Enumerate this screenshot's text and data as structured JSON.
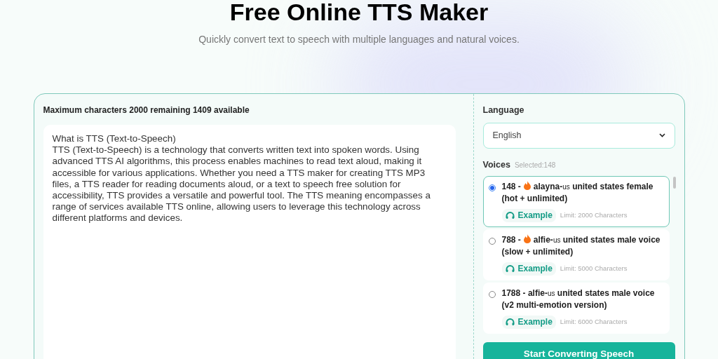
{
  "hero": {
    "title": "Free Online TTS Maker",
    "subtitle": "Quickly convert text to speech with multiple languages and natural voices."
  },
  "editor": {
    "counter": "Maximum characters 2000 remaining 1409 available",
    "text": "What is TTS (Text-to-Speech)\nTTS (Text-to-Speech) is a technology that converts written text into spoken words. Using advanced TTS AI algorithms, this process enables machines to read text aloud, making it accessible for various applications. Whether you need a TTS maker for creating TTS MP3 files, a TTS reader for reading documents aloud, or a text to speech free solution for accessibility, TTS provides a versatile and powerful tool. The TTS meaning encompasses a range of services available TTS online, allowing users to leverage this technology across different platforms and devices."
  },
  "settings": {
    "language_label": "Language",
    "language": "English",
    "voices_label": "Voices",
    "voices_selected": "Selected:148",
    "voices": [
      {
        "number": "148 -",
        "hot": true,
        "name": "alayna-",
        "locale": "us",
        "description": "united states female (hot + unlimited)",
        "example": "Example",
        "limit": "Limit: 2000 Characters",
        "selected": true
      },
      {
        "number": "788 -",
        "hot": true,
        "name": "alfie-",
        "locale": "us",
        "description": "united states male voice (slow + unlimited)",
        "example": "Example",
        "limit": "Limit: 5000 Characters",
        "selected": false
      },
      {
        "number": "1788 -",
        "hot": false,
        "name": "alfie-",
        "locale": "us",
        "description": "united states male voice (v2 multi-emotion version)",
        "example": "Example",
        "limit": "Limit: 6000 Characters",
        "selected": false
      }
    ],
    "convert_button": "Start Converting Speech"
  }
}
